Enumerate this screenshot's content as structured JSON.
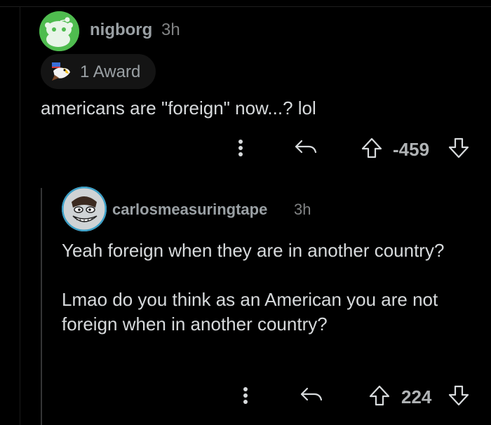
{
  "comments": [
    {
      "username": "nigborg",
      "time": "3h",
      "award_label": "1 Award",
      "body": "americans are \"foreign\" now...? lol",
      "score": "-459"
    },
    {
      "username": "carlosmeasuringtape",
      "time": "3h",
      "paragraphs": [
        "Yeah foreign when they are in another country?",
        "Lmao do you think as an American you are not foreign when in another country?"
      ],
      "score": "224"
    }
  ],
  "icons": {
    "avatar_1": "snoo-avatar-icon",
    "award": "eagle-award-icon",
    "more": "more-options-icon",
    "reply": "reply-icon",
    "upvote": "upvote-arrow-icon",
    "downvote": "downvote-arrow-icon",
    "avatar_2": "troll-face-avatar-icon"
  },
  "colors": {
    "background": "#000000",
    "text": "#d7dadc",
    "muted": "#818384",
    "avatar_green": "#4fbc4f",
    "award_pill": "#141414",
    "thread_line": "#343536"
  }
}
